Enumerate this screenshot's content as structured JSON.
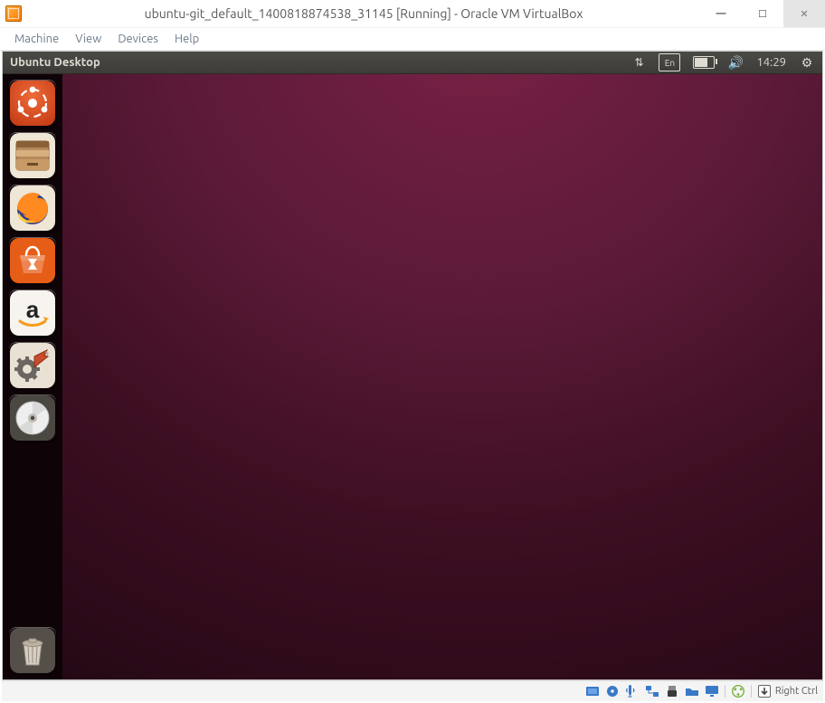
{
  "vb": {
    "title": "ubuntu-git_default_1400818874538_31145 [Running] - Oracle VM VirtualBox",
    "menu": {
      "machine": "Machine",
      "view": "View",
      "devices": "Devices",
      "help": "Help"
    },
    "status_host_key": "Right Ctrl"
  },
  "ubuntu": {
    "panel_title": "Ubuntu Desktop",
    "keyboard_indicator": "En",
    "time": "14:29"
  },
  "launcher": {
    "dash": "Dash",
    "files": "Files",
    "firefox": "Firefox",
    "software": "Ubuntu Software Center",
    "amazon": "Amazon",
    "settings": "System Settings",
    "disc": "Disc",
    "trash": "Trash"
  }
}
